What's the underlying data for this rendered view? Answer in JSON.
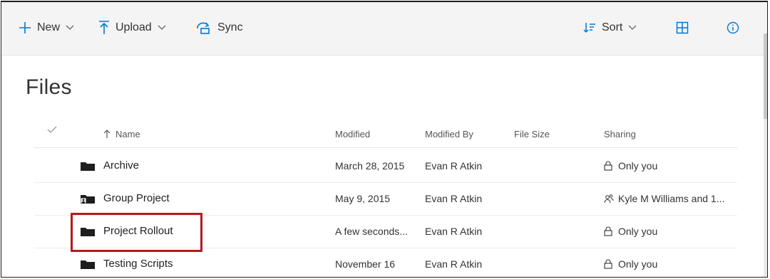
{
  "toolbar": {
    "new_label": "New",
    "upload_label": "Upload",
    "sync_label": "Sync",
    "sort_label": "Sort"
  },
  "page_title": "Files",
  "columns": {
    "name": "Name",
    "modified": "Modified",
    "modified_by": "Modified By",
    "file_size": "File Size",
    "sharing": "Sharing"
  },
  "rows": [
    {
      "name": "Archive",
      "modified": "March 28, 2015",
      "modified_by": "Evan R Atkin",
      "file_size": "",
      "sharing": "Only you",
      "shared": false
    },
    {
      "name": "Group Project",
      "modified": "May 9, 2015",
      "modified_by": "Evan R Atkin",
      "file_size": "",
      "sharing": "Kyle M Williams and 1...",
      "shared": true
    },
    {
      "name": "Project Rollout",
      "modified": "A few seconds...",
      "modified_by": "Evan R Atkin",
      "file_size": "",
      "sharing": "Only you",
      "shared": false
    },
    {
      "name": "Testing Scripts",
      "modified": "November 16",
      "modified_by": "Evan R Atkin",
      "file_size": "",
      "sharing": "Only you",
      "shared": false
    }
  ],
  "colors": {
    "accent": "#0078d4",
    "highlight_box": "#b31b1b",
    "command_bar_bg": "#f4f4f4"
  }
}
